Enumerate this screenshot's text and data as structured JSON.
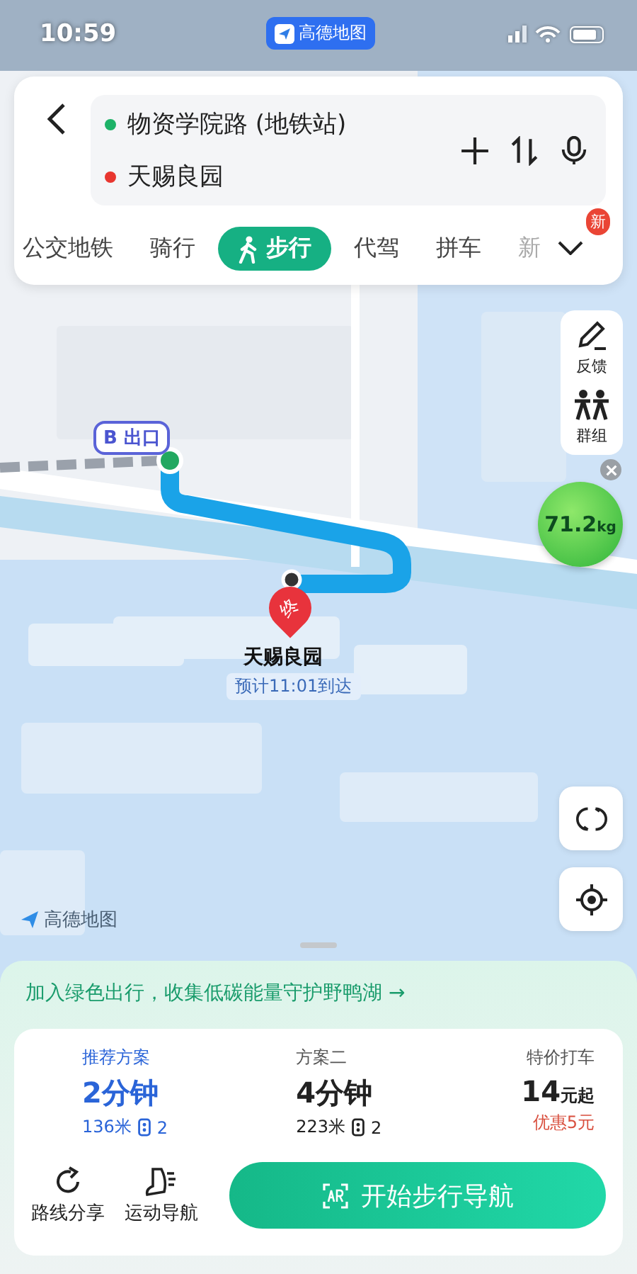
{
  "status_bar": {
    "time": "10:59"
  },
  "app_badge": {
    "label": "高德地图"
  },
  "route_search": {
    "origin": "物资学院路 (地铁站)",
    "destination": "天赐良园"
  },
  "modes": [
    {
      "label": "公交地铁",
      "selected": false,
      "truncated": false
    },
    {
      "label": "骑行",
      "selected": false,
      "truncated": false
    },
    {
      "label": "步行",
      "selected": true,
      "truncated": false
    },
    {
      "label": "代驾",
      "selected": false,
      "truncated": false
    },
    {
      "label": "拼车",
      "selected": false,
      "truncated": false
    },
    {
      "label": "新",
      "selected": false,
      "truncated": true
    }
  ],
  "more_badge": "新",
  "side_tools": [
    {
      "label": "反馈",
      "kind": "feedback"
    },
    {
      "label": "群组",
      "kind": "group"
    }
  ],
  "carbon_badge": {
    "value": "71.2",
    "unit": "kg"
  },
  "map_markers": {
    "exit_label": "B 出口",
    "end_pin": "终",
    "destination": "天赐良园",
    "eta": "预计11:01到达"
  },
  "map_logo": "高德地图",
  "promo": "加入绿色出行，收集低碳能量守护野鸭湖 →",
  "plans": [
    {
      "kind": "route",
      "title": "推荐方案",
      "time": "2分钟",
      "distance": "136米",
      "lights": "2",
      "selected": true
    },
    {
      "kind": "route",
      "title": "方案二",
      "time": "4分钟",
      "distance": "223米",
      "lights": "2",
      "selected": false
    },
    {
      "kind": "taxi",
      "title": "特价打车",
      "price": "14",
      "price_unit": "元起",
      "discount": "优惠5元"
    }
  ],
  "actions": [
    {
      "label": "路线分享",
      "kind": "share"
    },
    {
      "label": "运动导航",
      "kind": "sport"
    }
  ],
  "start_button": "开始步行导航"
}
